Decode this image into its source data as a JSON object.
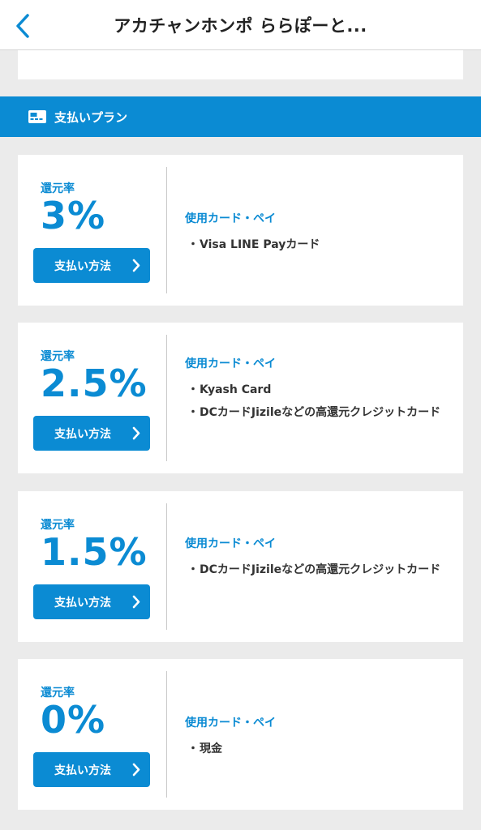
{
  "header": {
    "title": "アカチャンホンポ ららぽーと..."
  },
  "section": {
    "title": "支払いプラン",
    "icon": "card-icon"
  },
  "colors": {
    "accent": "#0b8bd3",
    "background": "#ebebeb"
  },
  "plans": [
    {
      "rate_label": "還元率",
      "rate": "3%",
      "button_label": "支払い方法",
      "cards_heading": "使用カード・ペイ",
      "cards": [
        "Visa LINE Payカード"
      ]
    },
    {
      "rate_label": "還元率",
      "rate": "2.5%",
      "button_label": "支払い方法",
      "cards_heading": "使用カード・ペイ",
      "cards": [
        "Kyash Card",
        "DCカードJizileなどの高還元クレジットカード"
      ]
    },
    {
      "rate_label": "還元率",
      "rate": "1.5%",
      "button_label": "支払い方法",
      "cards_heading": "使用カード・ペイ",
      "cards": [
        "DCカードJizileなどの高還元クレジットカード"
      ]
    },
    {
      "rate_label": "還元率",
      "rate": "0%",
      "button_label": "支払い方法",
      "cards_heading": "使用カード・ペイ",
      "cards": [
        "現金"
      ]
    }
  ],
  "bullet": "・"
}
